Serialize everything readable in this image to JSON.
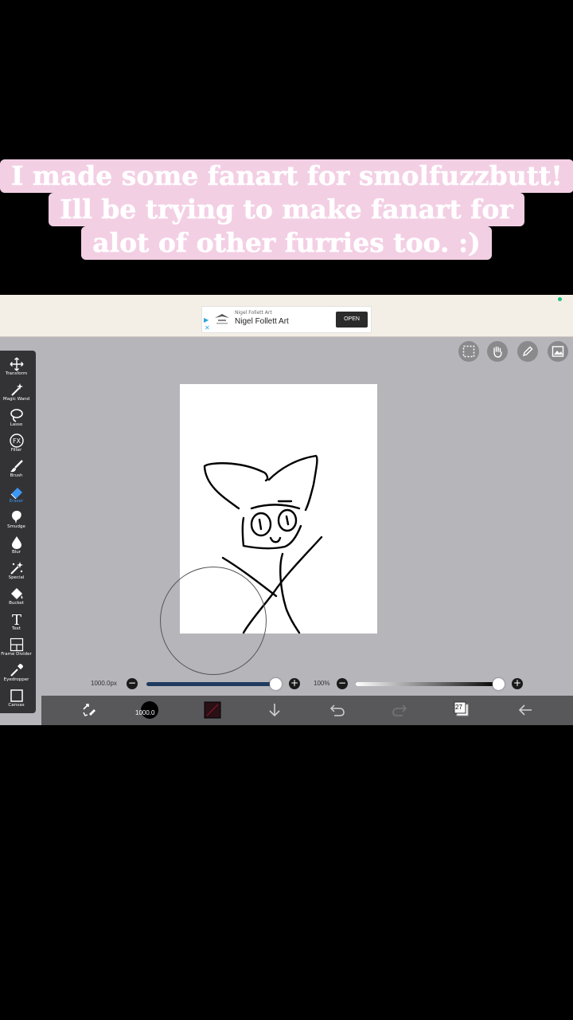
{
  "caption": {
    "lines": [
      "I made some fanart for smolfuzzbutt!",
      "Ill be trying to make fanart for",
      "alot of other furries too. :)"
    ]
  },
  "ad": {
    "advertiser_small": "Nigel Follett Art",
    "advertiser": "Nigel Follett Art",
    "open_label": "OPEN"
  },
  "tools": [
    {
      "label": "Transform",
      "icon": "transform-icon"
    },
    {
      "label": "Magic Wand",
      "icon": "magic-wand-icon"
    },
    {
      "label": "Lasso",
      "icon": "lasso-icon"
    },
    {
      "label": "Filter",
      "icon": "filter-icon"
    },
    {
      "label": "Brush",
      "icon": "brush-icon"
    },
    {
      "label": "Eraser",
      "icon": "eraser-icon",
      "active": true
    },
    {
      "label": "Smudge",
      "icon": "smudge-icon"
    },
    {
      "label": "Blur",
      "icon": "blur-icon"
    },
    {
      "label": "Special",
      "icon": "special-icon"
    },
    {
      "label": "Bucket",
      "icon": "bucket-icon"
    },
    {
      "label": "Text",
      "icon": "text-icon"
    },
    {
      "label": "Frame Divider",
      "icon": "frame-divider-icon"
    },
    {
      "label": "Eyedropper",
      "icon": "eyedropper-icon"
    },
    {
      "label": "Canvas",
      "icon": "canvas-icon"
    }
  ],
  "sliders": {
    "size_label": "1000.0px",
    "size_value_fraction": 1.0,
    "opacity_label": "100%",
    "opacity_value_fraction": 1.0
  },
  "bottom_bar": {
    "brush_size_label": "1000.0",
    "layer_count": "27",
    "color_swatch": "#2a0f14"
  },
  "colors": {
    "caption_bg": "#f3cfe4",
    "workspace_bg": "#b6b5ba",
    "active_tool": "#3c97f5"
  }
}
